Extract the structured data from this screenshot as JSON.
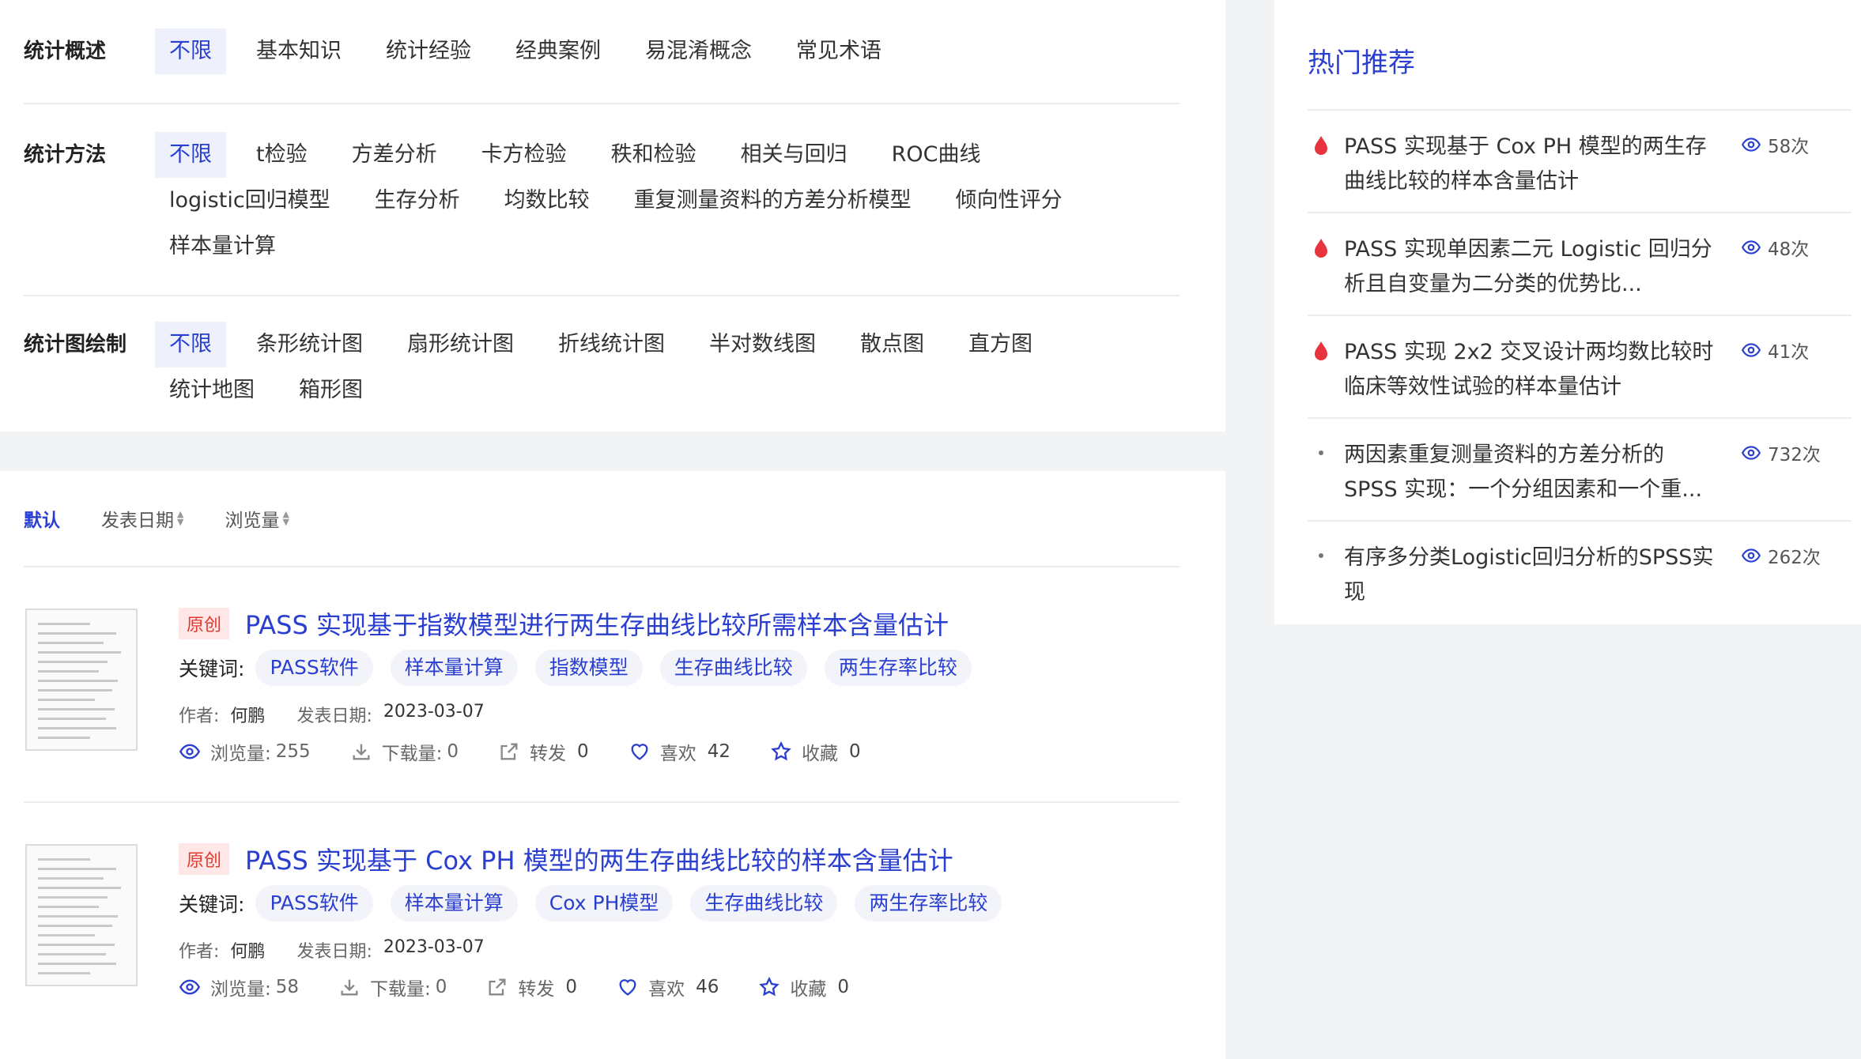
{
  "filters": [
    {
      "label": "统计概述",
      "options": [
        "不限",
        "基本知识",
        "统计经验",
        "经典案例",
        "易混淆概念",
        "常见术语"
      ]
    },
    {
      "label": "统计方法",
      "options": [
        "不限",
        "t检验",
        "方差分析",
        "卡方检验",
        "秩和检验",
        "相关与回归",
        "ROC曲线",
        "logistic回归模型",
        "生存分析",
        "均数比较",
        "重复测量资料的方差分析模型",
        "倾向性评分",
        "样本量计算"
      ]
    },
    {
      "label": "统计图绘制",
      "options": [
        "不限",
        "条形统计图",
        "扇形统计图",
        "折线统计图",
        "半对数线图",
        "散点图",
        "直方图",
        "统计地图",
        "箱形图"
      ]
    }
  ],
  "sort": {
    "default": "默认",
    "date": "发表日期",
    "views": "浏览量"
  },
  "labels": {
    "keywords": "关键词:",
    "author": "作者:",
    "date": "发表日期:",
    "views": "浏览量:",
    "downloads": "下载量:",
    "share": "转发",
    "like": "喜欢",
    "fav": "收藏"
  },
  "articles": [
    {
      "badge": "原创",
      "title": "PASS 实现基于指数模型进行两生存曲线比较所需样本含量估计",
      "keywords": [
        "PASS软件",
        "样本量计算",
        "指数模型",
        "生存曲线比较",
        "两生存率比较"
      ],
      "author": "何鹏",
      "date": "2023-03-07",
      "views": "255",
      "downloads": "0",
      "shares": "0",
      "likes": "42",
      "favorites": "0"
    },
    {
      "badge": "原创",
      "title": "PASS 实现基于 Cox PH 模型的两生存曲线比较的样本含量估计",
      "keywords": [
        "PASS软件",
        "样本量计算",
        "Cox PH模型",
        "生存曲线比较",
        "两生存率比较"
      ],
      "author": "何鹏",
      "date": "2023-03-07",
      "views": "58",
      "downloads": "0",
      "shares": "0",
      "likes": "46",
      "favorites": "0"
    }
  ],
  "sidebar": {
    "title": "热门推荐",
    "items": [
      {
        "title": "PASS 实现基于 Cox PH 模型的两生存曲线比较的样本含量估计",
        "views": "58次",
        "hot": true
      },
      {
        "title": "PASS 实现单因素二元 Logistic 回归分析且自变量为二分类的优势比...",
        "views": "48次",
        "hot": true
      },
      {
        "title": "PASS 实现 2x2 交叉设计两均数比较时临床等效性试验的样本量估计",
        "views": "41次",
        "hot": true
      },
      {
        "title": "两因素重复测量资料的方差分析的 SPSS 实现：一个分组因素和一个重...",
        "views": "732次",
        "hot": false
      },
      {
        "title": "有序多分类Logistic回归分析的SPSS实现",
        "views": "262次",
        "hot": false
      }
    ]
  },
  "colors": {
    "accent": "#2a3fcf",
    "hot": "#e8343f",
    "badge_bg": "#ffe7e7",
    "badge_text": "#e0392f"
  }
}
